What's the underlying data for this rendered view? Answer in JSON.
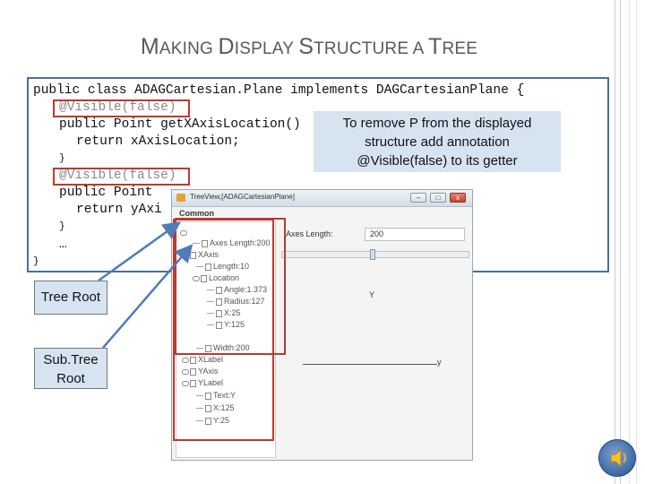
{
  "slide": {
    "title_parts": [
      {
        "text": "M",
        "size": "big"
      },
      {
        "text": "AKING ",
        "size": "small"
      },
      {
        "text": "D",
        "size": "big"
      },
      {
        "text": "ISPLAY ",
        "size": "small"
      },
      {
        "text": "S",
        "size": "big"
      },
      {
        "text": "TRUCTURE A ",
        "size": "small"
      },
      {
        "text": "T",
        "size": "big"
      },
      {
        "text": "REE",
        "size": "small"
      }
    ]
  },
  "code": {
    "line1": "public class ADAGCartesian.Plane implements DAGCartesianPlane {",
    "line2": "@Visible(false)",
    "line3": "public Point getXAxisLocation()",
    "line4": "return xAxisLocation;",
    "line5": "}",
    "line6": "@Visible(false)",
    "line7": "public Point",
    "line8": "return yAxi",
    "line9": "}",
    "line10": "…",
    "line11": "}"
  },
  "callout": {
    "l1": "To remove  P from the displayed",
    "l2": "structure add annotation",
    "l3": "@Visible(false) to its getter"
  },
  "tree_window": {
    "title": "TreeView,[ADAGCartesianPlane]",
    "menu": "Common",
    "min_btn": "–",
    "max_btn": "□",
    "close_btn": "x",
    "nodes": [
      "Axes Length:200",
      "XAxis",
      "Length:10",
      "Location",
      "Angle:1.373",
      "Radius:127",
      "X:25",
      "Y:125",
      "Width:200",
      "XLabel",
      "YAxis",
      "YLabel",
      "Text:Y",
      "X:125",
      "Y:25"
    ],
    "axes_length_label": "Axes Length:",
    "axes_length_value": "200",
    "y_label": "Y",
    "y_right": "y"
  },
  "labels": {
    "tree_root": "Tree Root",
    "subtree_l1": "Sub.Tree",
    "subtree_l2": "Root"
  },
  "colors": {
    "frame_border": "#4f6f97",
    "highlight": "#c0392b",
    "callout_bg": "#d6e4f2",
    "arrow": "#4f7cba"
  }
}
